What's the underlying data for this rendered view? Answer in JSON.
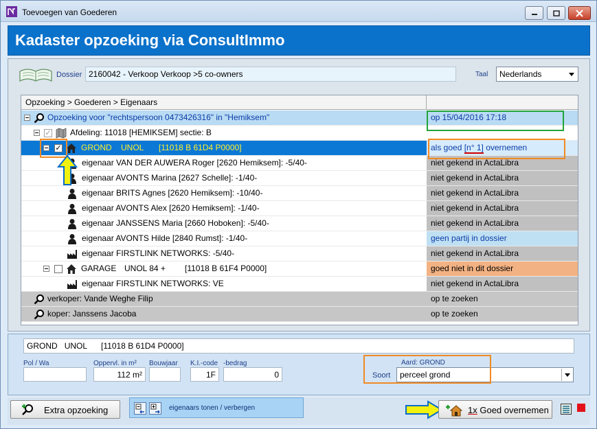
{
  "window": {
    "title": "Toevoegen van Goederen",
    "app_icon": "app-icon"
  },
  "header": {
    "title": "Kadaster opzoeking via ConsultImmo"
  },
  "top": {
    "dossier_label": "Dossier",
    "dossier_value": "2160042 - Verkoop Verkoop >5 co-owners",
    "taal_label": "Taal",
    "taal_value": "Nederlands"
  },
  "tree": {
    "breadcrumb": "Opzoeking > Goederen > Eigenaars",
    "rows": [
      {
        "text": "Opzoeking voor \"rechtspersoon 0473426316\" in \"Hemiksem\"",
        "status": "op 15/04/2016 17:18"
      },
      {
        "text": "Afdeling: 11018 [HEMIKSEM]   sectie: B",
        "status": ""
      },
      {
        "kind": "GROND",
        "unit": "UNOL",
        "ref": "[11018 B 61D4 P0000]",
        "status_pre": "als goed ",
        "status_mark": "[n° 1]",
        "status_post": " overnemen"
      },
      {
        "text": "eigenaar VAN DER AUWERA Roger [2620 Hemiksem]: -5/40-",
        "status": "niet gekend in ActaLibra"
      },
      {
        "text": "eigenaar AVONTS Marina [2627 Schelle]: -1/40-",
        "status": "niet gekend in ActaLibra"
      },
      {
        "text": "eigenaar BRITS Agnes [2620 Hemiksem]: -10/40-",
        "status": "niet gekend in ActaLibra"
      },
      {
        "text": "eigenaar AVONTS Alex [2620 Hemiksem]: -1/40-",
        "status": "niet gekend in ActaLibra"
      },
      {
        "text": "eigenaar JANSSENS Maria [2660 Hoboken]: -5/40-",
        "status": "niet gekend in ActaLibra"
      },
      {
        "text": "eigenaar AVONTS Hilde [2840 Rumst]: -1/40-",
        "status": "geen partij in dossier"
      },
      {
        "text": "eigenaar FIRSTLINK NETWORKS: -5/40-",
        "status": "niet gekend in ActaLibra"
      },
      {
        "kind": "GARAGE",
        "unit": "UNOL 84 +",
        "ref": "[11018 B 61F4 P0000]",
        "status": "goed niet in dit dossier"
      },
      {
        "text": "eigenaar FIRSTLINK NETWORKS: VE",
        "status": "niet gekend in ActaLibra"
      },
      {
        "text": "verkoper: Vande Weghe Filip",
        "status": "op te zoeken"
      },
      {
        "text": "koper: Janssens Jacoba",
        "status": "op te zoeken"
      }
    ]
  },
  "detail": {
    "kind": "GROND",
    "unit": "UNOL",
    "ref": "[11018 B 61D4 P0000]",
    "pol_label": "Pol / Wa",
    "pol_value": "",
    "opp_label": "Oppervl. in m²",
    "opp_value": "112 m²",
    "bouw_label": "Bouwjaar",
    "bouw_value": "",
    "ki_label": "K.I.-code",
    "ki_value": "1F",
    "bedrag_label": "-bedrag",
    "bedrag_value": "0",
    "aard_label": "Aard: GROND",
    "soort_label": "Soort",
    "soort_value": "perceel grond"
  },
  "footer": {
    "extra_label": "Extra opzoeking",
    "toggle_label": "eigenaars tonen / verbergen",
    "overnemen_prefix": "1x",
    "overnemen_suffix": " Goed overnemen"
  },
  "colors": {
    "header_blue": "#0b72cb",
    "selection_blue": "#0b78d6",
    "annotation_orange": "#f08a24",
    "annotation_green": "#22a43a",
    "annotation_arrow": "#f3f10f"
  }
}
